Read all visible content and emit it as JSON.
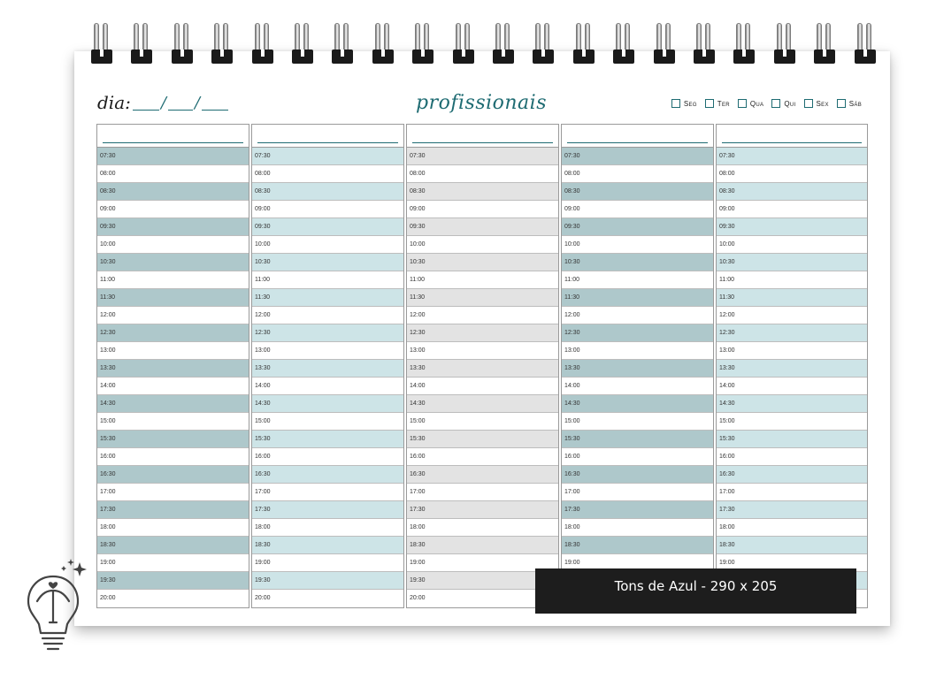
{
  "header": {
    "dia_label": "dia:",
    "dia_slash": "/",
    "title": "profissionais",
    "days": [
      "Seg",
      "Ter",
      "Qua",
      "Qui",
      "Sex",
      "Sáb"
    ]
  },
  "times": [
    "07:30",
    "08:00",
    "08:30",
    "09:00",
    "09:30",
    "10:00",
    "10:30",
    "11:00",
    "11:30",
    "12:00",
    "12:30",
    "13:00",
    "13:30",
    "14:00",
    "14:30",
    "15:00",
    "15:30",
    "16:00",
    "16:30",
    "17:00",
    "17:30",
    "18:00",
    "18:30",
    "19:00",
    "19:30",
    "20:00"
  ],
  "columns": [
    {
      "stripe": "#aec8cb"
    },
    {
      "stripe": "#cde4e7"
    },
    {
      "stripe": "#e3e3e3"
    },
    {
      "stripe": "#aec8cb"
    },
    {
      "stripe": "#cde4e7"
    }
  ],
  "banner": {
    "text": "Tons de Azul - 290 x 205"
  },
  "colors": {
    "accent": "#1e6b72",
    "banner_bg": "#1d1d1d"
  },
  "icons": {
    "logo": "lightbulb-logo-icon"
  }
}
